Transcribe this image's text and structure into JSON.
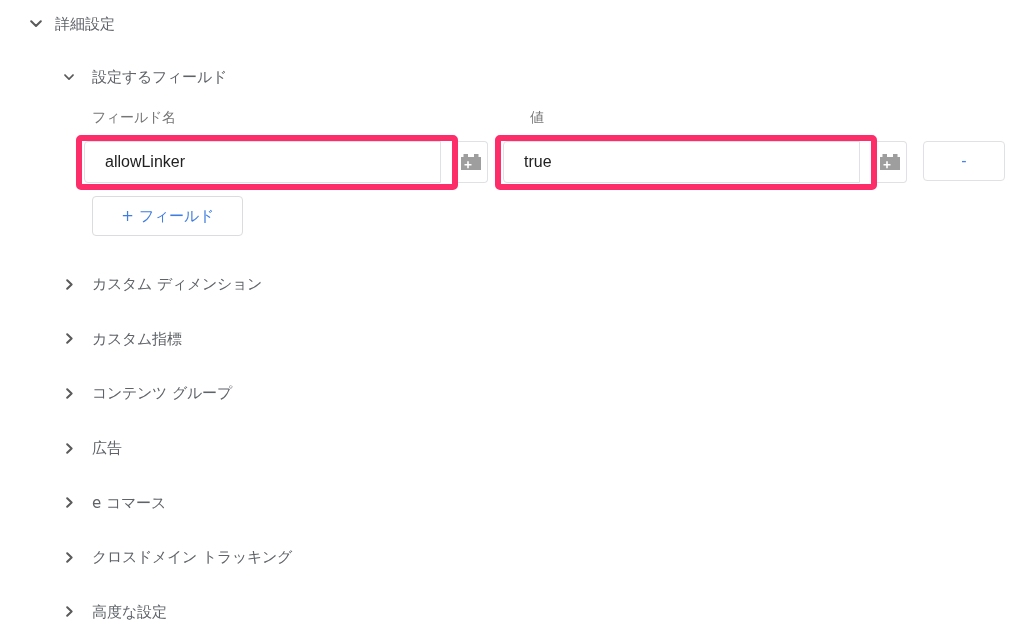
{
  "section": {
    "title": "詳細設定",
    "expanded": true,
    "subsections": [
      {
        "title": "設定するフィールド",
        "expanded": true,
        "fields_table": {
          "columns": [
            "フィールド名",
            "値"
          ],
          "rows": [
            {
              "name": {
                "value": "allowLinker",
                "highlighted": true
              },
              "value": {
                "value": "true",
                "highlighted": true
              },
              "remove_button": "-"
            }
          ],
          "add_button": "+ フィールド"
        }
      },
      {
        "title": "カスタム ディメンション",
        "expanded": false
      },
      {
        "title": "カスタム指標",
        "expanded": false
      },
      {
        "title": "コンテンツ グループ",
        "expanded": false
      },
      {
        "title": "広告",
        "expanded": false
      },
      {
        "title": "e コマース",
        "expanded": false
      },
      {
        "title": "クロスドメイン トラッキング",
        "expanded": false
      },
      {
        "title": "高度な設定",
        "expanded": false
      }
    ]
  }
}
